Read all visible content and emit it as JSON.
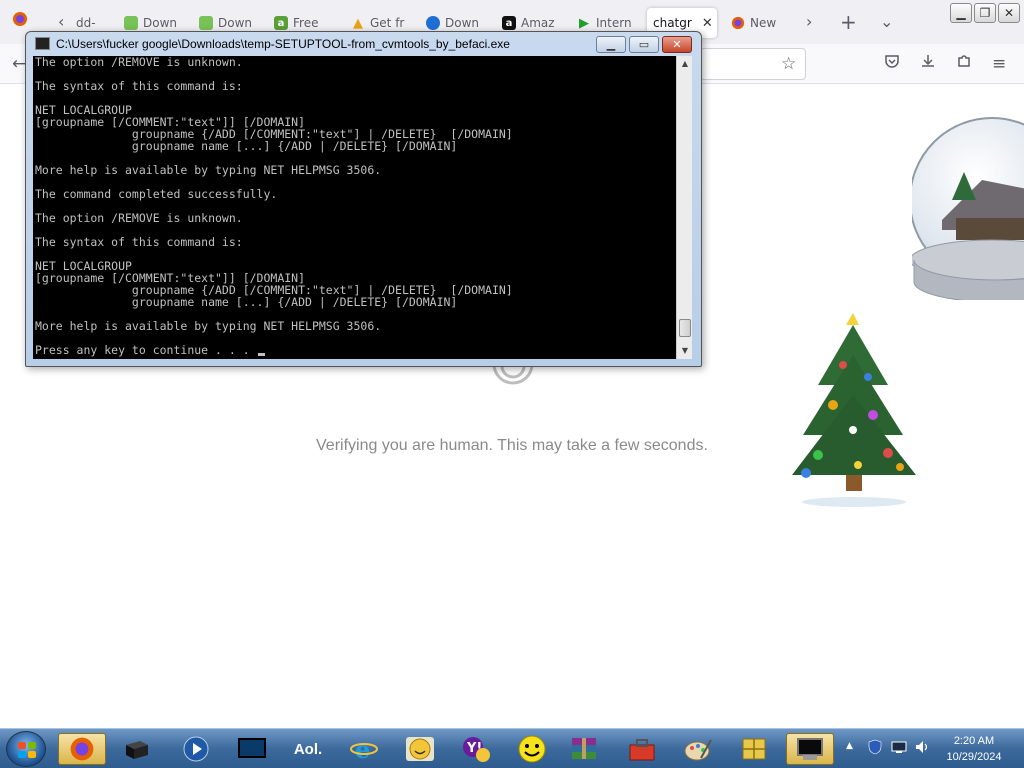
{
  "browser": {
    "tabs": [
      {
        "label": "dd-",
        "favicon": "firefox-icon",
        "color": "#e66000"
      },
      {
        "label": "Down",
        "favicon": "android-icon",
        "color": "#78c257"
      },
      {
        "label": "Down",
        "favicon": "android-icon",
        "color": "#78c257"
      },
      {
        "label": "Free",
        "favicon": "a-icon",
        "color": "#5ba037"
      },
      {
        "label": "Get fr",
        "favicon": "warning-icon",
        "color": "#e8a317"
      },
      {
        "label": "Down",
        "favicon": "bird-icon",
        "color": "#1d6fd6"
      },
      {
        "label": "Amaz",
        "favicon": "amazon-icon",
        "color": "#111111"
      },
      {
        "label": "Intern",
        "favicon": "play-icon",
        "color": "#1fa02b"
      },
      {
        "label": "chatgr",
        "favicon": "",
        "color": "#ffffff",
        "active": true
      },
      {
        "label": "New",
        "favicon": "firefox-icon",
        "color": "#e66000"
      }
    ],
    "controls": {
      "new_tab": "+",
      "list_all": "⌄",
      "scroll_right": "›"
    }
  },
  "page": {
    "verify_text": "Verifying you are human. This may take a few seconds."
  },
  "cmd": {
    "title": "C:\\Users\\fucker google\\Downloads\\temp-SETUPTOOL-from_cvmtools_by_befaci.exe",
    "lines": [
      "The option /REMOVE is unknown.",
      "",
      "The syntax of this command is:",
      "",
      "NET LOCALGROUP",
      "[groupname [/COMMENT:\"text\"]] [/DOMAIN]",
      "              groupname {/ADD [/COMMENT:\"text\"] | /DELETE}  [/DOMAIN]",
      "              groupname name [...] {/ADD | /DELETE} [/DOMAIN]",
      "",
      "More help is available by typing NET HELPMSG 3506.",
      "",
      "The command completed successfully.",
      "",
      "The option /REMOVE is unknown.",
      "",
      "The syntax of this command is:",
      "",
      "NET LOCALGROUP",
      "[groupname [/COMMENT:\"text\"]] [/DOMAIN]",
      "              groupname {/ADD [/COMMENT:\"text\"] | /DELETE}  [/DOMAIN]",
      "              groupname name [...] {/ADD | /DELETE} [/DOMAIN]",
      "",
      "More help is available by typing NET HELPMSG 3506.",
      "",
      "Press any key to continue . . . "
    ]
  },
  "taskbar": {
    "apps": [
      {
        "name": "firefox-taskbar-icon",
        "active": true
      },
      {
        "name": "cube-app-taskbar-icon"
      },
      {
        "name": "media-player-taskbar-icon"
      },
      {
        "name": "monitor-app-taskbar-icon"
      },
      {
        "name": "aol-taskbar-icon",
        "label": "Aol."
      },
      {
        "name": "internet-explorer-taskbar-icon"
      },
      {
        "name": "smiley-messenger-taskbar-icon"
      },
      {
        "name": "yahoo-messenger-taskbar-icon"
      },
      {
        "name": "smiley-taskbar-icon"
      },
      {
        "name": "winrar-taskbar-icon"
      },
      {
        "name": "toolbox-taskbar-icon"
      },
      {
        "name": "paint-taskbar-icon"
      },
      {
        "name": "puzzle-taskbar-icon"
      },
      {
        "name": "cmd-taskbar-icon",
        "active": true
      }
    ],
    "clock": {
      "time": "2:20 AM",
      "date": "10/29/2024"
    }
  }
}
